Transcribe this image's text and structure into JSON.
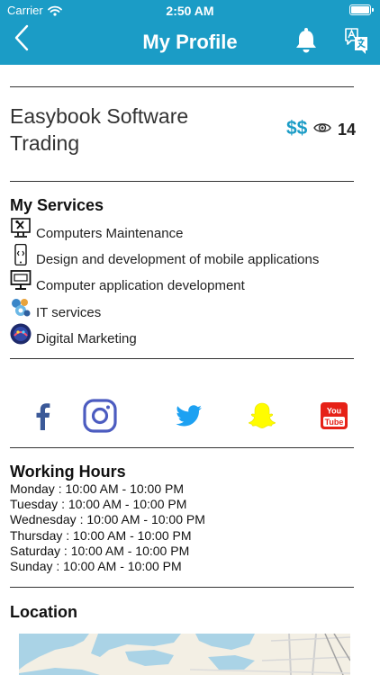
{
  "status_bar": {
    "carrier": "Carrier",
    "time": "2:50 AM"
  },
  "header": {
    "title": "My Profile"
  },
  "icons": {
    "back": "chevron-left-icon",
    "notifications": "bell-icon",
    "language": "translate-icon",
    "views": "eye-icon"
  },
  "colors": {
    "brand": "#1b9cc6",
    "facebook": "#3b5998",
    "instagram": "#4c5cc0",
    "twitter": "#1da1f2",
    "snapchat": "#fffc00",
    "youtube": "#e62117"
  },
  "business": {
    "name": "Easybook Software Trading",
    "price_level": "$$",
    "views": "14"
  },
  "services": {
    "title": "My Services",
    "items": [
      {
        "label": "Computers Maintenance",
        "icon": "computer-repair-icon"
      },
      {
        "label": "Design and development of mobile applications",
        "icon": "mobile-app-icon"
      },
      {
        "label": "Computer application development",
        "icon": "computer-app-icon"
      },
      {
        "label": "IT services",
        "icon": "it-services-icon"
      },
      {
        "label": "Digital Marketing",
        "icon": "digital-marketing-icon"
      }
    ]
  },
  "social": [
    "facebook-icon",
    "instagram-icon",
    "twitter-icon",
    "snapchat-icon",
    "youtube-icon"
  ],
  "youtube_badge": {
    "line1": "You",
    "line2": "Tube"
  },
  "working_hours": {
    "title": "Working Hours",
    "days": [
      {
        "day": "Monday",
        "hours": "10:00 AM - 10:00 PM"
      },
      {
        "day": "Tuesday",
        "hours": "10:00 AM - 10:00 PM"
      },
      {
        "day": "Wednesday",
        "hours": "10:00 AM - 10:00 PM"
      },
      {
        "day": "Thursday",
        "hours": "10:00 AM - 10:00 PM"
      },
      {
        "day": "Saturday",
        "hours": "10:00 AM - 10:00 PM"
      },
      {
        "day": "Sunday",
        "hours": "10:00 AM - 10:00 PM"
      }
    ]
  },
  "location": {
    "title": "Location"
  }
}
